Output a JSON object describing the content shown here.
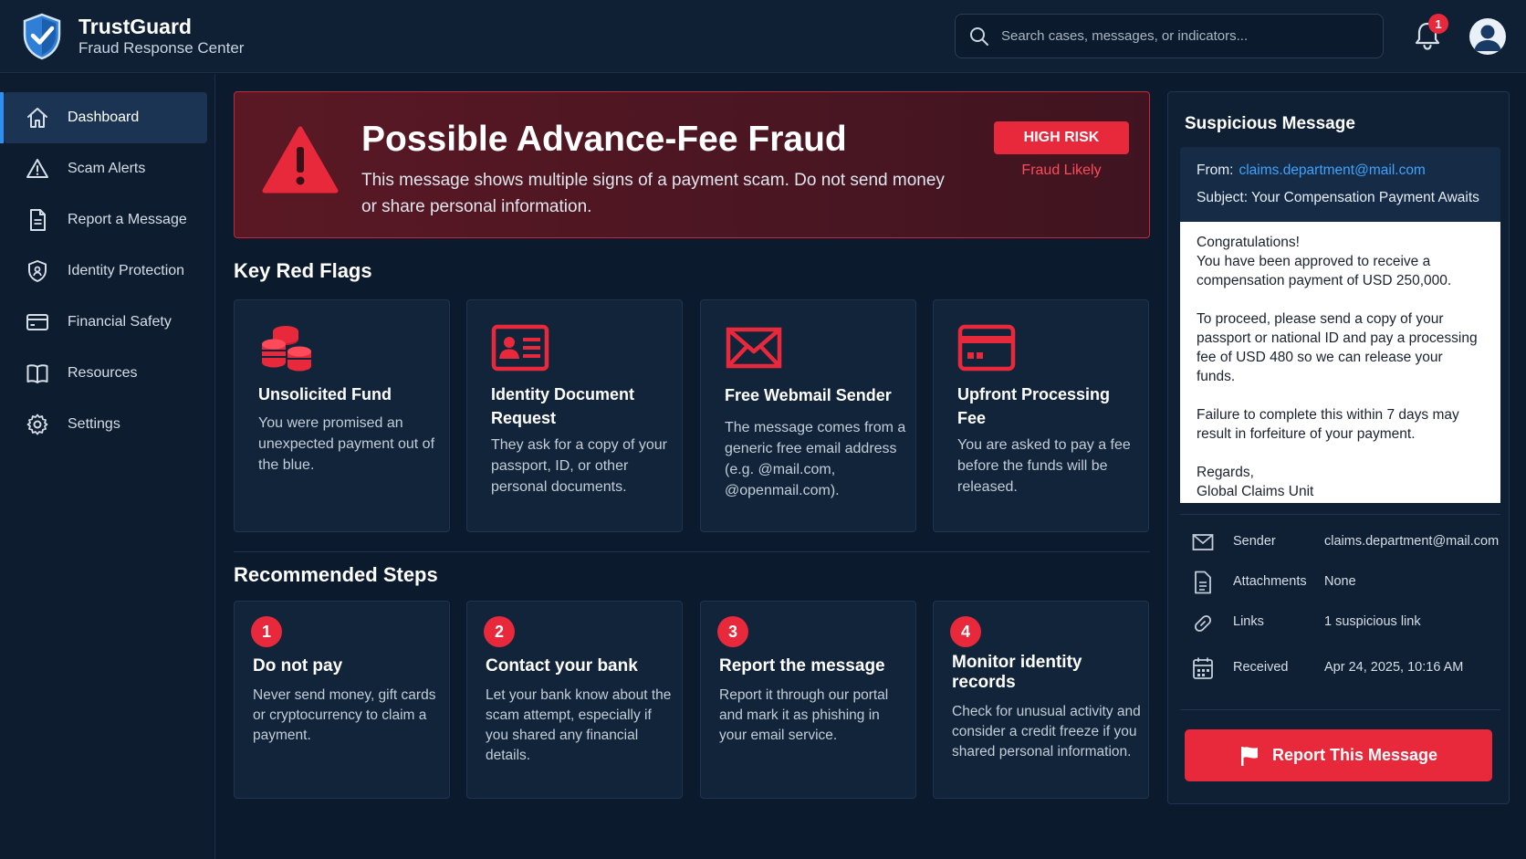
{
  "app": {
    "name": "TrustGuard",
    "subtitle": "Fraud Response Center"
  },
  "header": {
    "search_placeholder": "Search cases, messages, or indicators...",
    "notification_count": "1"
  },
  "sidebar": {
    "items": [
      {
        "label": "Dashboard",
        "icon": "home-icon",
        "active": true
      },
      {
        "label": "Scam Alerts",
        "icon": "warning-icon"
      },
      {
        "label": "Report a Message",
        "icon": "document-icon"
      },
      {
        "label": "Identity Protection",
        "icon": "shield-icon"
      },
      {
        "label": "Financial Safety",
        "icon": "credit-card-icon"
      },
      {
        "label": "Resources",
        "icon": "book-icon"
      },
      {
        "label": "Settings",
        "icon": "gear-icon"
      }
    ]
  },
  "alert": {
    "title": "Possible Advance-Fee Fraud",
    "description": "This message shows multiple signs of a payment scam. Do not send money or share personal information.",
    "risk_label": "HIGH RISK",
    "risk_sub": "Fraud Likely"
  },
  "red_flags": {
    "title": "Key Red Flags",
    "items": [
      {
        "title": "Unsolicited Fund",
        "description": "You were promised an unexpected payment out of the blue.",
        "icon": "coins-icon"
      },
      {
        "title": "Identity Document Request",
        "description": "They ask for a copy of your passport, ID, or other personal documents.",
        "icon": "id-card-icon"
      },
      {
        "title": "Free Webmail Sender",
        "description": "The message comes from a generic free email address (e.g. @mail.com, @openmail.com).",
        "icon": "envelope-icon"
      },
      {
        "title": "Upfront Processing Fee",
        "description": "You are asked to pay a fee before the funds will be released.",
        "icon": "credit-card-icon"
      }
    ]
  },
  "steps": {
    "title": "Recommended Steps",
    "items": [
      {
        "number": "1",
        "title": "Do not pay",
        "description": "Never send money, gift cards or cryptocurrency to claim a payment."
      },
      {
        "number": "2",
        "title": "Contact your bank",
        "description": "Let your bank know about the scam attempt, especially if you shared any financial details."
      },
      {
        "number": "3",
        "title": "Report the message",
        "description": "Report it through our portal and mark it as phishing in your email service."
      },
      {
        "number": "4",
        "title": "Monitor identity records",
        "description": "Check for unusual activity and consider a credit freeze if you shared personal information."
      }
    ]
  },
  "message": {
    "panel_title": "Suspicious Message",
    "from_label": "From:",
    "from": "claims.department@mail.com",
    "subject_label": "Subject:",
    "subject": "Your Compensation Payment Awaits",
    "body": [
      "Congratulations!\nYou have been approved to receive a compensation payment of USD 250,000.",
      "To proceed, please send a copy of your passport or national ID and pay a processing fee of USD 480 so we can release your funds.",
      "Failure to complete this within 7 days may result in forfeiture of your payment.",
      "Regards,\nGlobal Claims Unit"
    ],
    "meta": [
      {
        "label": "Sender",
        "value": "claims.department@mail.com",
        "icon": "envelope-icon"
      },
      {
        "label": "Attachments",
        "value": "None",
        "icon": "document-icon"
      },
      {
        "label": "Links",
        "value": "1 suspicious link",
        "icon": "link-icon"
      },
      {
        "label": "Received",
        "value": "Apr 24, 2025, 10:16 AM",
        "icon": "calendar-icon"
      }
    ],
    "report_button": "Report This Message"
  },
  "colors": {
    "accent_red": "#e8283b",
    "link_blue": "#3fa3ff",
    "background": "#0b1a2c"
  }
}
